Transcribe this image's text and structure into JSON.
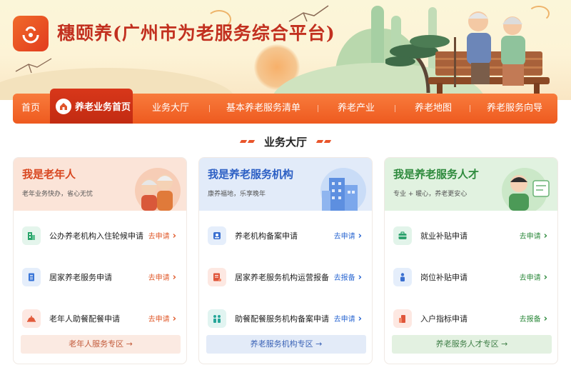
{
  "header": {
    "site_title": "穗颐养(广州市为老服务综合平台)"
  },
  "nav": {
    "items": [
      {
        "label": "首页"
      },
      {
        "label": "养老业务首页"
      },
      {
        "label": "业务大厅"
      },
      {
        "label": "基本养老服务清单"
      },
      {
        "label": "养老产业"
      },
      {
        "label": "养老地图"
      },
      {
        "label": "养老服务向导"
      }
    ],
    "active_index": 1
  },
  "section": {
    "title": "业务大厅"
  },
  "cards": [
    {
      "title": "我是老年人",
      "subtitle": "老年业务快办，省心无忧",
      "title_color": "#d8461f",
      "head_bg": "#fbe4d8",
      "rows": [
        {
          "label": "公办养老机构入住轮候申请",
          "action": "去申请",
          "icon": "building-icon"
        },
        {
          "label": "居家养老服务申请",
          "action": "去申请",
          "icon": "document-icon"
        },
        {
          "label": "老年人助餐配餐申请",
          "action": "去申请",
          "icon": "meal-cover-icon"
        }
      ],
      "footer": "老年人服务专区 →",
      "accent": "#e05a2b",
      "footer_bg": "#fbeae2",
      "footer_color": "#c25a3a"
    },
    {
      "title": "我是养老服务机构",
      "subtitle": "康养福地，乐享晚年",
      "title_color": "#2c5fc4",
      "head_bg": "#e2ebf9",
      "rows": [
        {
          "label": "养老机构备案申请",
          "action": "去申请",
          "icon": "badge-icon"
        },
        {
          "label": "居家养老服务机构运营报备",
          "action": "去报备",
          "icon": "report-icon"
        },
        {
          "label": "助餐配餐服务机构备案申请",
          "action": "去申请",
          "icon": "people-icon"
        }
      ],
      "footer": "养老服务机构专区 →",
      "accent": "#2c68d2",
      "footer_bg": "#e3ebf8",
      "footer_color": "#3b63b6"
    },
    {
      "title": "我是养老服务人才",
      "subtitle": "专业 + 暖心，养老更安心",
      "title_color": "#2e8a3d",
      "head_bg": "#e1f2e0",
      "rows": [
        {
          "label": "就业补贴申请",
          "action": "去申请",
          "icon": "briefcase-icon"
        },
        {
          "label": "岗位补贴申请",
          "action": "去申请",
          "icon": "worker-icon"
        },
        {
          "label": "入户指标申请",
          "action": "去报备",
          "icon": "household-icon"
        }
      ],
      "footer": "养老服务人才专区 →",
      "accent": "#2e8a3d",
      "footer_bg": "#e3f1e1",
      "footer_color": "#3f7f47"
    }
  ]
}
